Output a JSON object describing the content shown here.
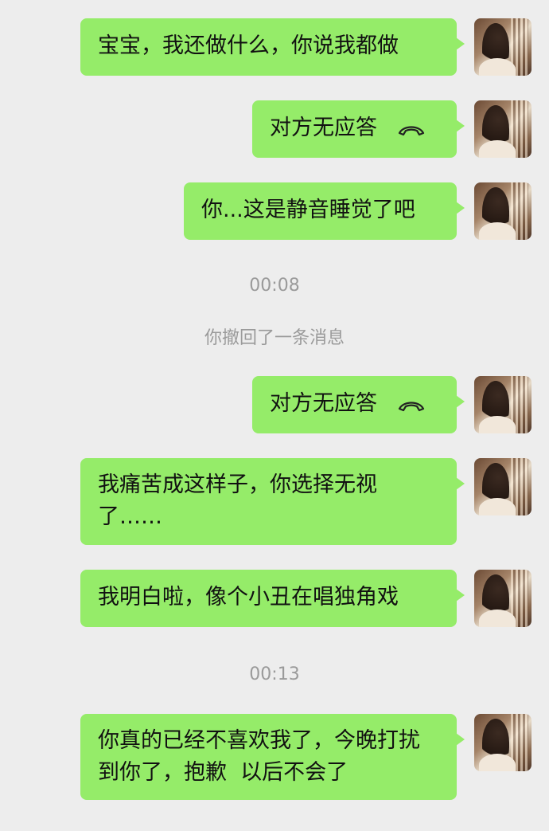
{
  "messages": [
    {
      "text": "宝宝，我还做什么，你说我都做"
    },
    {
      "text": "对方无应答",
      "icon": "phone-hangup-icon"
    },
    {
      "text": "你...这是静音睡觉了吧"
    },
    {
      "text": "对方无应答",
      "icon": "phone-hangup-icon"
    },
    {
      "text": "我痛苦成这样子，你选择无视了……"
    },
    {
      "text": "我明白啦，像个小丑在唱独角戏"
    },
    {
      "text": "你真的已经不喜欢我了，今晚打扰到你了，抱歉  以后不会了"
    }
  ],
  "system": {
    "time1": "00:08",
    "recall": "你撤回了一条消息",
    "time2": "00:13"
  },
  "colors": {
    "background": "#ededed",
    "bubble": "#95ec69",
    "system_text": "#9a9a9a"
  }
}
